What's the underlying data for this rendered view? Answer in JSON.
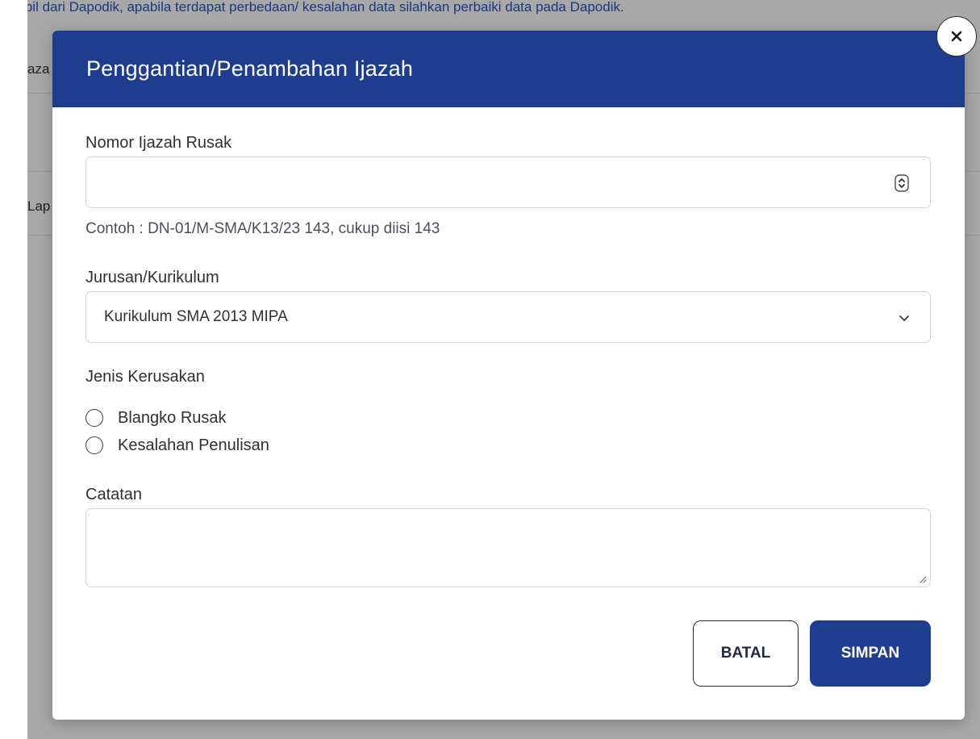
{
  "background": {
    "notice_text": "diambil dari Dapodik, apabila terdapat perbedaan/ kesalahan data silahkan perbaiki data pada Dapodik.",
    "fragment_1": "aza",
    "fragment_2": "Lap"
  },
  "modal": {
    "title": "Penggantian/Penambahan Ijazah",
    "close_icon": "close-icon",
    "nomor_label": "Nomor Ijazah Rusak",
    "nomor_value": "",
    "nomor_hint": "Contoh : DN-01/M-SMA/K13/23 143, cukup diisi 143",
    "jurusan_label": "Jurusan/Kurikulum",
    "jurusan_selected": "Kurikulum SMA 2013 MIPA",
    "jenis_label": "Jenis Kerusakan",
    "jenis_options": [
      "Blangko Rusak",
      "Kesalahan Penulisan"
    ],
    "catatan_label": "Catatan",
    "catatan_value": "",
    "batal_label": "BATAL",
    "simpan_label": "SIMPAN"
  },
  "colors": {
    "primary": "#1f3d8f",
    "link": "#2b54c2",
    "border": "#cfd4dc"
  }
}
